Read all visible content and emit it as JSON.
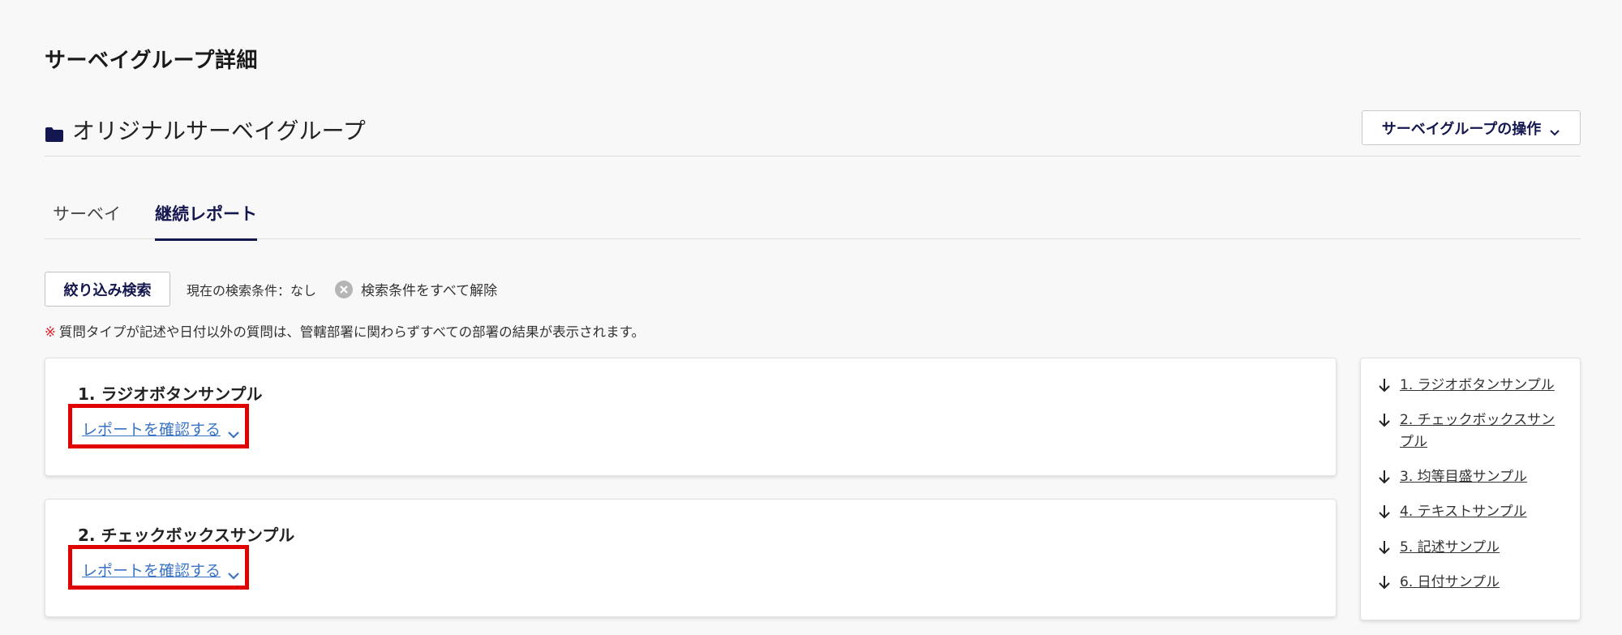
{
  "page": {
    "title": "サーベイグループ詳細"
  },
  "group": {
    "name": "オリジナルサーベイグループ",
    "icon": "folder-icon",
    "operations_label": "サーベイグループの操作"
  },
  "tabs": [
    {
      "label": "サーベイ",
      "active": false
    },
    {
      "label": "継続レポート",
      "active": true
    }
  ],
  "filter": {
    "button_label": "絞り込み検索",
    "current_conditions": "現在の検索条件：なし",
    "clear_label": "検索条件をすべて解除"
  },
  "notice": {
    "mark": "※",
    "text": "質問タイプが記述や日付以外の質問は、管轄部署に関わらずすべての部署の結果が表示されます。"
  },
  "cards": [
    {
      "title": "1. ラジオボタンサンプル",
      "link_label": "レポートを確認する"
    },
    {
      "title": "2. チェックボックスサンプル",
      "link_label": "レポートを確認する"
    }
  ],
  "toc": [
    {
      "label": "1. ラジオボタンサンプル"
    },
    {
      "label": "2. チェックボックスサンプル"
    },
    {
      "label": "3. 均等目盛サンプル"
    },
    {
      "label": "4. テキストサンプル"
    },
    {
      "label": "5. 記述サンプル"
    },
    {
      "label": "6. 日付サンプル"
    }
  ],
  "colors": {
    "accent": "#14174f",
    "link": "#3a73c4",
    "highlight": "#e00000",
    "notice_mark": "#e4202b"
  }
}
